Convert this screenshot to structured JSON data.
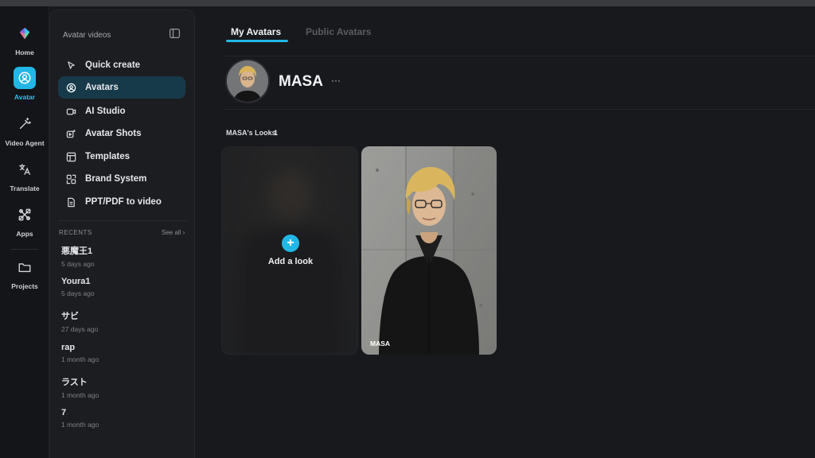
{
  "rail": {
    "items": [
      {
        "label": "Home",
        "icon": "logo-icon"
      },
      {
        "label": "Avatar",
        "icon": "avatar-icon",
        "active": true
      },
      {
        "label": "Video Agent",
        "icon": "magic-wand-icon"
      },
      {
        "label": "Translate",
        "icon": "translate-icon"
      },
      {
        "label": "Apps",
        "icon": "apps-icon"
      },
      {
        "label": "Projects",
        "icon": "folder-icon"
      }
    ]
  },
  "sidebar": {
    "heading": "Avatar videos",
    "nav": [
      {
        "label": "Quick create",
        "icon": "cursor-icon"
      },
      {
        "label": "Avatars",
        "icon": "avatar-circle-icon",
        "active": true
      },
      {
        "label": "AI Studio",
        "icon": "video-camera-icon"
      },
      {
        "label": "Avatar Shots",
        "icon": "sparkle-video-icon"
      },
      {
        "label": "Templates",
        "icon": "template-icon"
      },
      {
        "label": "Brand System",
        "icon": "brand-icon"
      },
      {
        "label": "PPT/PDF to video",
        "icon": "document-icon"
      }
    ],
    "recents_title": "RECENTS",
    "see_all": "See all ›",
    "recents": [
      {
        "name": "悪魔王1",
        "time": "5 days ago"
      },
      {
        "name": "Youra1",
        "time": "5 days ago"
      },
      {
        "name": "サビ",
        "time": "27 days ago"
      },
      {
        "name": "rap",
        "time": "1 month ago"
      },
      {
        "name": "ラスト",
        "time": "1 month ago"
      },
      {
        "name": "7",
        "time": "1 month ago"
      }
    ]
  },
  "main": {
    "tabs": [
      {
        "label": "My Avatars",
        "active": true
      },
      {
        "label": "Public Avatars",
        "active": false
      }
    ],
    "avatar_name": "MASA",
    "more": "···",
    "looks_label": "MASA's Looks",
    "looks_count": "1",
    "add_look": "Add a look",
    "look_card_name": "MASA"
  },
  "colors": {
    "accent": "#22b7e6",
    "background": "#18191c",
    "sidebar": "#1c1d21",
    "active_nav": "#173a4a"
  }
}
